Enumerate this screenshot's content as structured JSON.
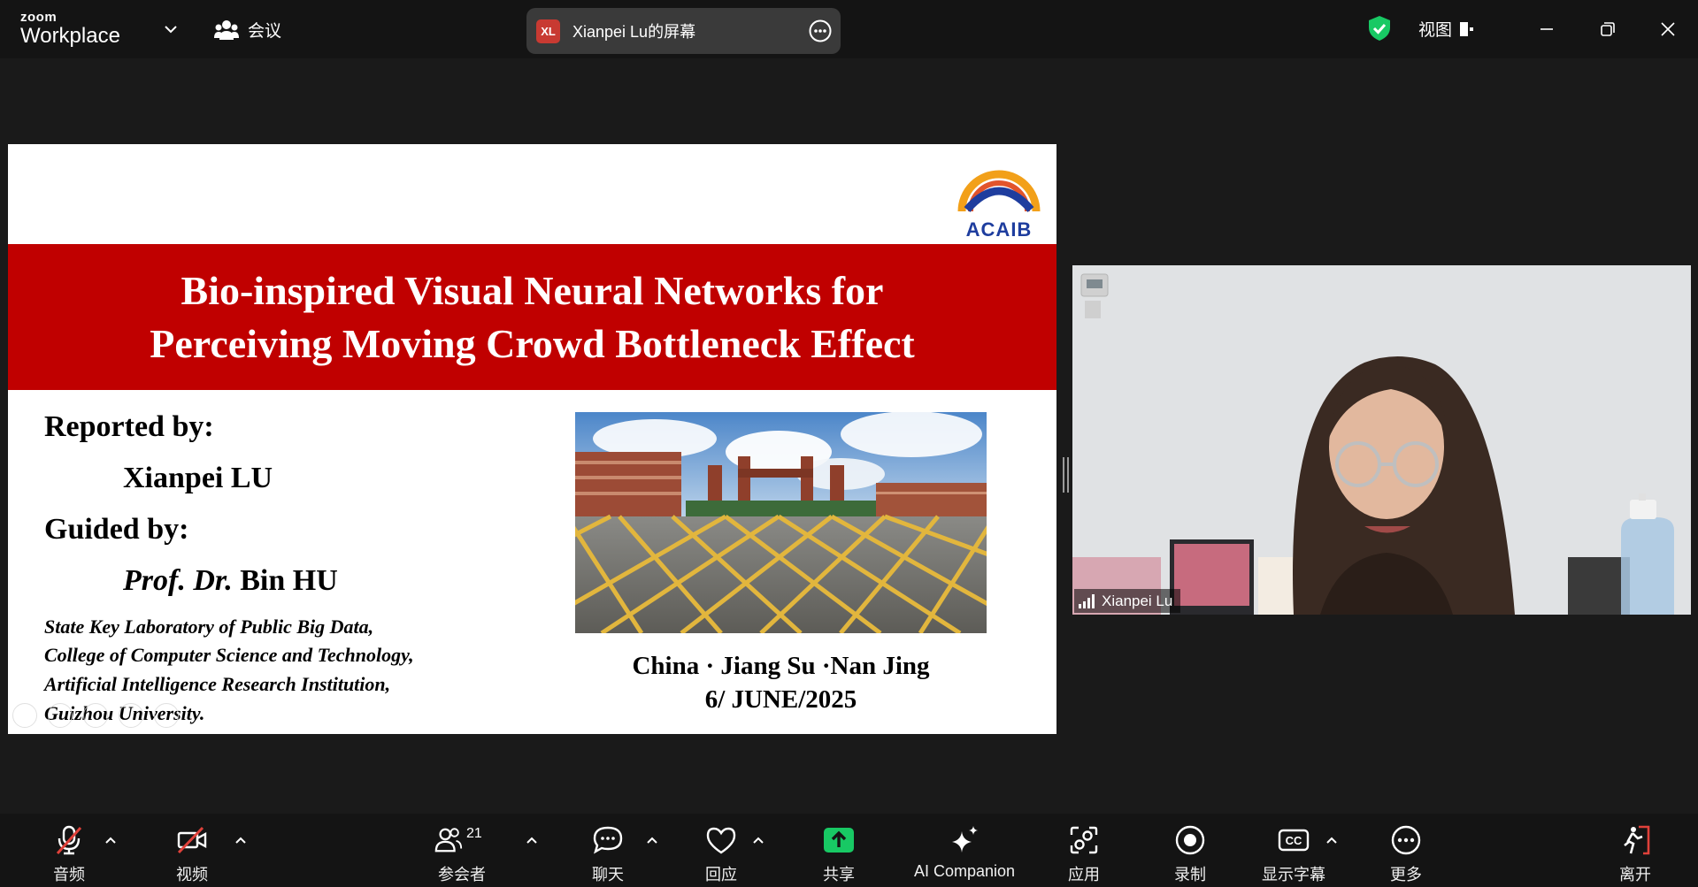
{
  "app": {
    "brand_small": "zoom",
    "brand_large": "Workplace",
    "meeting_label": "会议"
  },
  "share": {
    "initials": "XL",
    "title": "Xianpei Lu的屏幕"
  },
  "window": {
    "view_label": "视图"
  },
  "slide": {
    "logo_text": "ACAIB",
    "title_line1": "Bio-inspired Visual Neural Networks for",
    "title_line2": "Perceiving Moving Crowd Bottleneck Effect",
    "reported_label": "Reported by:",
    "reported_name": "Xianpei LU",
    "guided_label": "Guided by:",
    "guided_prefix": "Prof. Dr.",
    "guided_name": " Bin HU",
    "affiliation": [
      "State Key Laboratory of Public Big Data,",
      "College of Computer Science and Technology,",
      "Artificial Intelligence Research Institution,",
      "Guizhou University."
    ],
    "location": "China · Jiang Su ·Nan Jing",
    "date": "6/ JUNE/2025"
  },
  "video": {
    "participant_name": "Xianpei Lu"
  },
  "toolbar": {
    "audio": "音频",
    "video": "视频",
    "participants": "参会者",
    "participants_count": "21",
    "chat": "聊天",
    "react": "回应",
    "share": "共享",
    "ai_companion": "AI Companion",
    "apps": "应用",
    "record": "录制",
    "captions": "显示字幕",
    "more": "更多",
    "leave": "离开"
  },
  "colors": {
    "title_band": "#c00000",
    "share_green": "#18c964",
    "leave_red": "#e0413a",
    "logo_blue": "#1e3d9e"
  }
}
